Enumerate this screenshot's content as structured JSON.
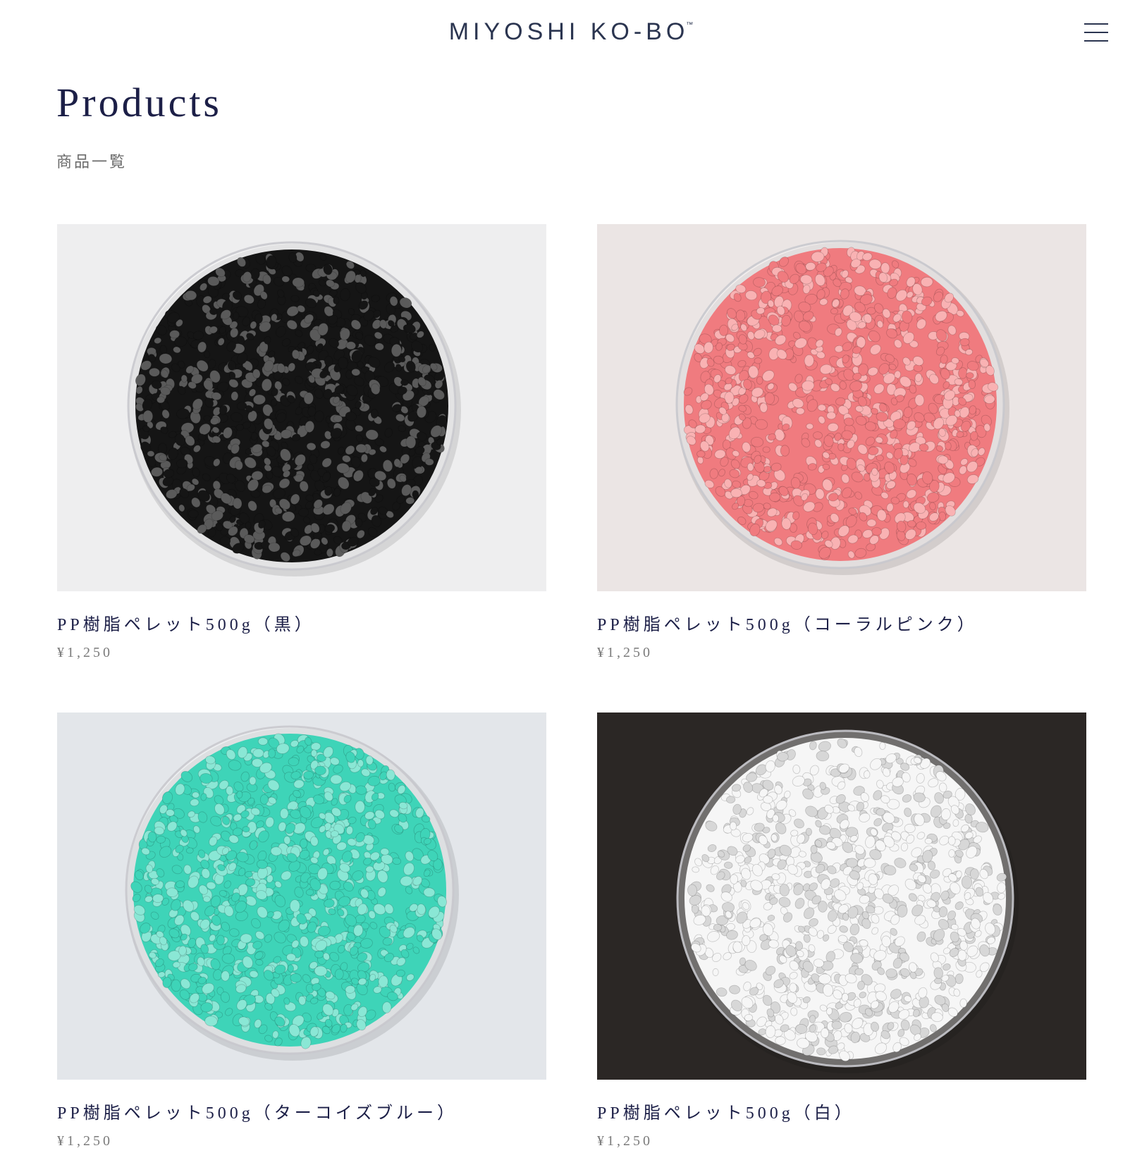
{
  "header": {
    "brand": "MIYOSHI KO-BO",
    "trademark": "™"
  },
  "page": {
    "title": "Products",
    "subtitle": "商品一覧"
  },
  "products": [
    {
      "name": "PP樹脂ペレット500g（黒）",
      "price": "¥1,250",
      "pellet_color": "#151515",
      "pellet_highlight": "#5a5a5a",
      "background": "#eeeeef"
    },
    {
      "name": "PP樹脂ペレット500g（コーラルピンク）",
      "price": "¥1,250",
      "pellet_color": "#f07b7f",
      "pellet_highlight": "#f9b2b3",
      "background": "#ebe5e4"
    },
    {
      "name": "PP樹脂ペレット500g（ターコイズブルー）",
      "price": "¥1,250",
      "pellet_color": "#3ed4b8",
      "pellet_highlight": "#8ae7d5",
      "background": "#e3e6ea"
    },
    {
      "name": "PP樹脂ペレット500g（白）",
      "price": "¥1,250",
      "pellet_color": "#f6f6f6",
      "pellet_highlight": "#d7d7d7",
      "background": "#2b2725"
    }
  ]
}
